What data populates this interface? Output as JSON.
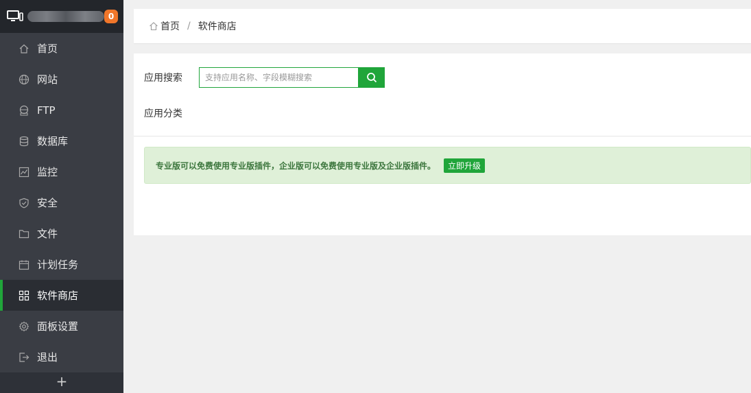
{
  "sidebar": {
    "badge": "0",
    "items": [
      {
        "label": "首页",
        "icon": "home-icon"
      },
      {
        "label": "网站",
        "icon": "globe-icon"
      },
      {
        "label": "FTP",
        "icon": "ftp-icon"
      },
      {
        "label": "数据库",
        "icon": "database-icon"
      },
      {
        "label": "监控",
        "icon": "monitor-chart-icon"
      },
      {
        "label": "安全",
        "icon": "shield-icon"
      },
      {
        "label": "文件",
        "icon": "folder-icon"
      },
      {
        "label": "计划任务",
        "icon": "calendar-icon"
      },
      {
        "label": "软件商店",
        "icon": "grid-apps-icon",
        "active": true
      },
      {
        "label": "面板设置",
        "icon": "gear-icon"
      },
      {
        "label": "退出",
        "icon": "logout-icon"
      }
    ],
    "add_label": "+"
  },
  "breadcrumb": {
    "home": "首页",
    "separator": "/",
    "current": "软件商店"
  },
  "search": {
    "label": "应用搜索",
    "placeholder": "支持应用名称、字段模糊搜索"
  },
  "category": {
    "label": "应用分类"
  },
  "notice": {
    "text": "专业版可以免费使用专业版插件，企业版可以免费使用专业版及企业版插件。",
    "button": "立即升级"
  },
  "colors": {
    "accent": "#20a53a",
    "sidebar_bg": "#3a3d44",
    "badge": "#f0762a",
    "notice_bg": "#dff0d8"
  }
}
